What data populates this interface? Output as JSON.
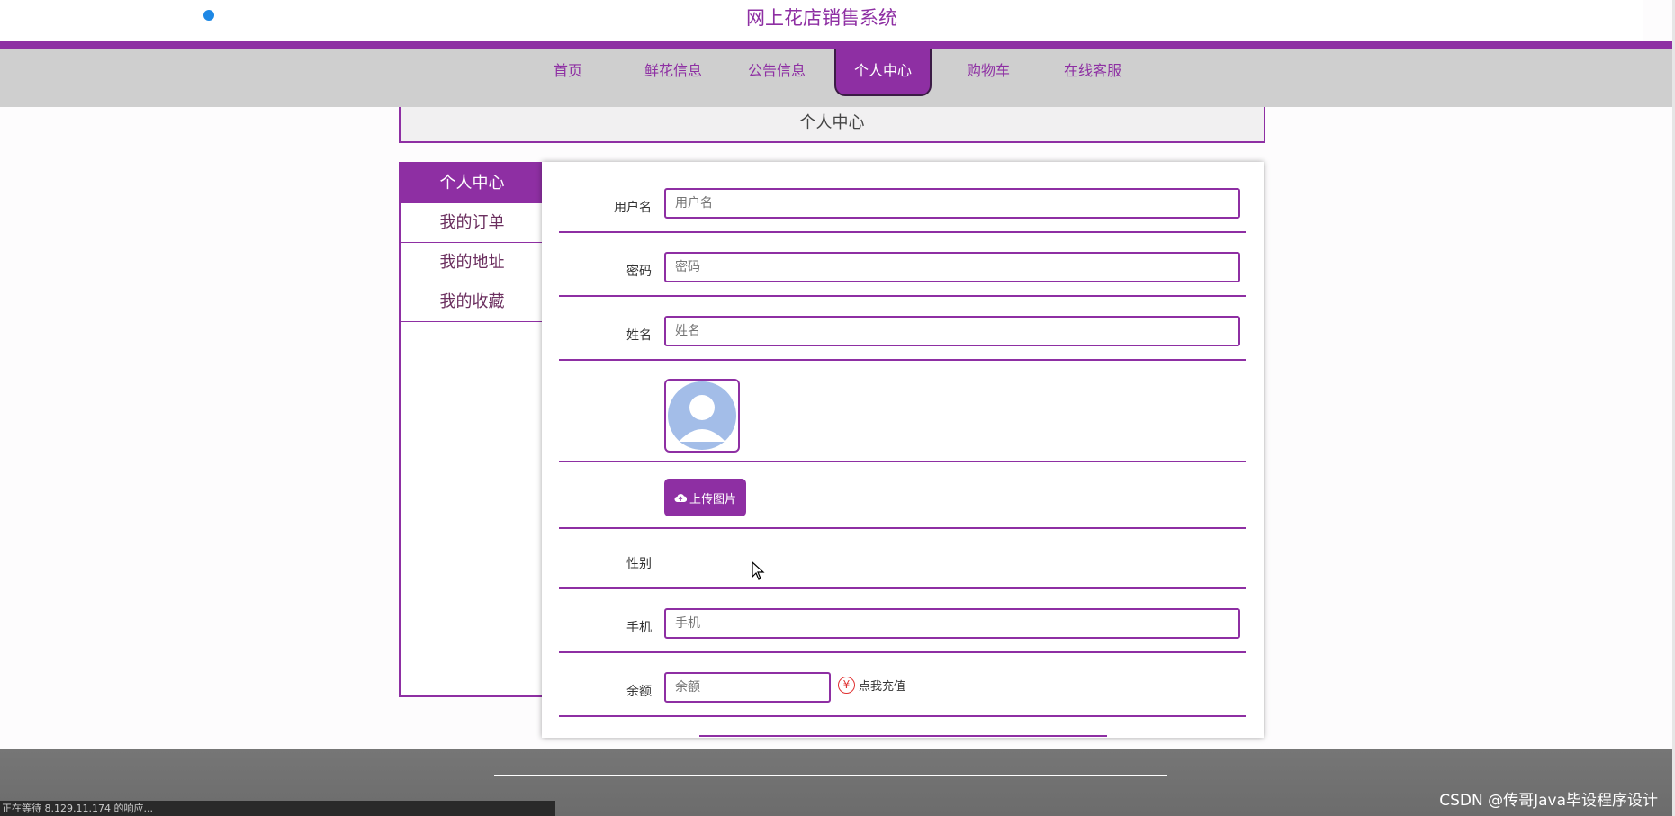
{
  "site": {
    "title": "网上花店销售系统"
  },
  "nav": {
    "items": [
      {
        "label": "首页"
      },
      {
        "label": "鲜花信息"
      },
      {
        "label": "公告信息"
      },
      {
        "label": "个人中心"
      },
      {
        "label": "购物车"
      },
      {
        "label": "在线客服"
      }
    ],
    "active": "个人中心"
  },
  "page": {
    "header": "个人中心"
  },
  "sidebar": {
    "items": [
      {
        "label": "个人中心"
      },
      {
        "label": "我的订单"
      },
      {
        "label": "我的地址"
      },
      {
        "label": "我的收藏"
      }
    ]
  },
  "form": {
    "username": {
      "label": "用户名",
      "placeholder": "用户名"
    },
    "password": {
      "label": "密码",
      "placeholder": "密码"
    },
    "name": {
      "label": "姓名",
      "placeholder": "姓名"
    },
    "upload_label": "上传图片",
    "gender": {
      "label": "性别"
    },
    "phone": {
      "label": "手机",
      "placeholder": "手机"
    },
    "balance": {
      "label": "余额",
      "placeholder": "余额"
    },
    "recharge_label": "点我充值",
    "recharge_icon": "yen-circle-icon"
  },
  "footer": {
    "watermark": "CSDN @传哥Java毕设程序设计"
  },
  "status_bar": {
    "text": "正在等待 8.129.11.174 的响应..."
  },
  "colors": {
    "accent": "#8e2fa3",
    "footer": "#6e6e6e",
    "recharge": "#e03131"
  }
}
